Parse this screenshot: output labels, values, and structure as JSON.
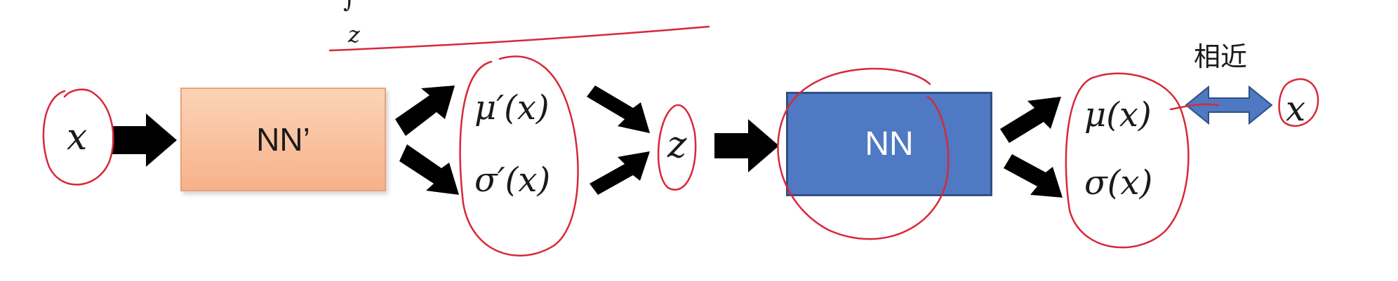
{
  "diagram": {
    "top_symbol_integral": "∫",
    "top_symbol_z": "z",
    "input_x": "x",
    "encoder_label": "NN’",
    "encoder_mu": "μ′(x)",
    "encoder_sigma": "σ′(x)",
    "latent_z": "z",
    "decoder_label": "NN",
    "decoder_mu": "μ(x)",
    "decoder_sigma": "σ(x)",
    "similar_label": "相近",
    "output_x": "x"
  },
  "colors": {
    "encoder_fill": "#f7bf98",
    "decoder_fill": "#4f79c2",
    "arrow": "#000000",
    "double_arrow": "#4f79c2",
    "annotation": "#d8283a"
  }
}
